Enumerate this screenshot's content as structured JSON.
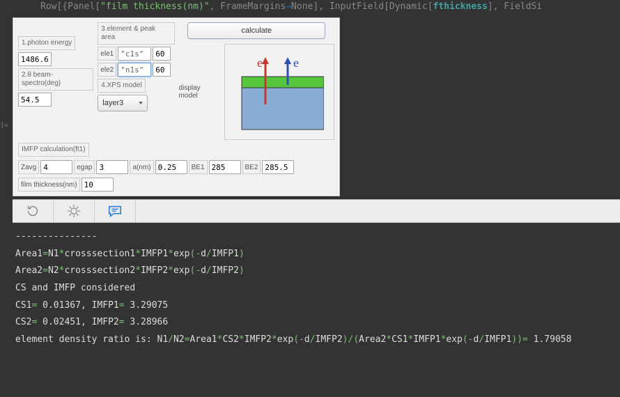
{
  "code_preview": {
    "leading": "Row[{Panel[",
    "string_open": "\"",
    "string_body": "film thickness(nm)",
    "string_close": "\"",
    "mid1": ", FrameMargins",
    "arrow": "→",
    "mid2": "None], InputField[Dynamic[",
    "var": "fthickness",
    "trail": "], FieldSi"
  },
  "out_label": "]=",
  "left": {
    "photon_energy_label": "1.photon energy",
    "photon_energy_value": "1486.6",
    "theta_label": "2.θ beam-spectro(deg)",
    "theta_value": "54.5"
  },
  "center": {
    "elem_label": "3.element & peak area",
    "ele1_tag": "ele1",
    "ele1_name": "\"c1s\"",
    "ele1_area": "60",
    "ele2_tag": "ele2",
    "ele2_name": "\"n1s\"",
    "ele2_area": "60",
    "xps_label": "4.XPS model",
    "xps_value": "layer3"
  },
  "right": {
    "calculate_label": "calculate",
    "display_model_label": "display model",
    "e_label_left": "e",
    "e_label_right": "e"
  },
  "imfp": {
    "header": "IMFP calculation(ft1)",
    "zavg": "Zavg",
    "zavg_v": "4",
    "egap": "egap",
    "egap_v": "3",
    "anm": "a(nm)",
    "anm_v": "0.25",
    "be1": "BE1",
    "be1_v": "285",
    "be2": "BE2",
    "be2_v": "285.5",
    "film": "film thickness(nm)",
    "film_v": "10"
  },
  "output": {
    "dashes": "---------------",
    "line1a": "Area1",
    "eq": "=",
    "line1b": "N1",
    "star": "*",
    "line1c": "crosssection1",
    "line1d": "IMFP1",
    "exp": "exp",
    "lp": "(",
    "minus": "-",
    "d": "d",
    "slash": "/",
    "rp": ")",
    "line2b": "N2",
    "line2c": "crosssection2",
    "line2d": "IMFP2",
    "line3": "CS and IMFP considered",
    "cs1": "CS1",
    "cs1v": "0.01367",
    "imfp1": "IMFP1",
    "imfp1v": "3.29075",
    "cs2": "CS2",
    "cs2v": "0.02451",
    "imfp2": "IMFP2",
    "imfp2v": "3.28966",
    "ratio_a": "element density ratio is: N1",
    "ratio_b": "N2",
    "ratio_c": "Area1",
    "ratio_d": "CS2",
    "ratio_e": "IMFP2",
    "ratio_f": "Area2",
    "ratio_g": "CS1",
    "ratio_h": "IMFP1",
    "ratio_v": "1.79058"
  },
  "colors": {
    "top_layer": "#56c63f",
    "bottom_layer": "#89add6",
    "arrow_red": "#c0392b",
    "arrow_blue": "#2e4fb5"
  }
}
